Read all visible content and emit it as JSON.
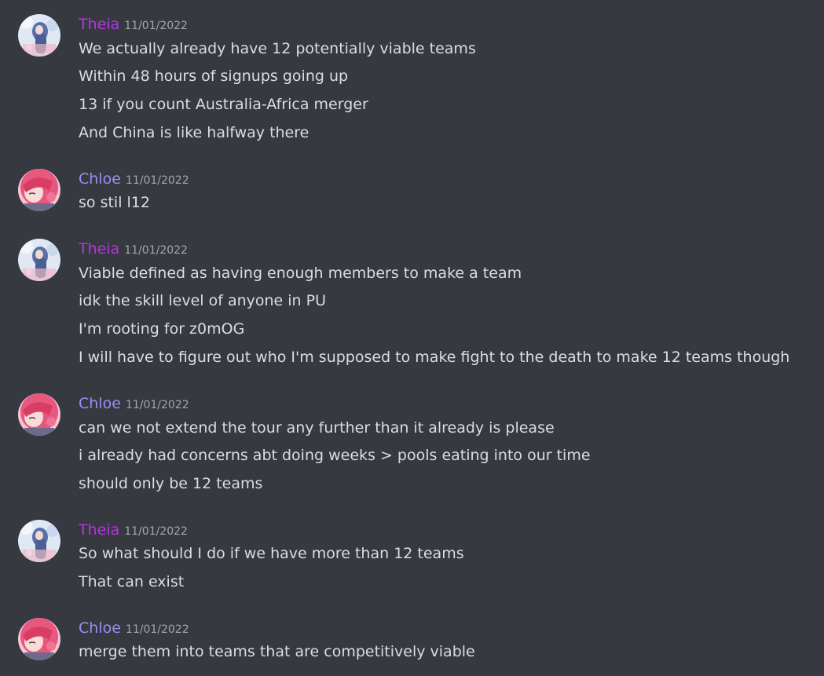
{
  "colors": {
    "background": "#36393f",
    "theia_name": "#b436e0",
    "chloe_name": "#9b8cf5",
    "text": "#dcddde",
    "timestamp": "#a3a6aa"
  },
  "messages": [
    {
      "author": "Theia",
      "timestamp": "11/01/2022",
      "avatar_icon": "blue-anime-character-avatar",
      "lines": [
        "We actually already have 12 potentially viable teams",
        "Within 48 hours of signups going up",
        "13 if you count Australia-Africa merger",
        "And China is like halfway there"
      ]
    },
    {
      "author": "Chloe",
      "timestamp": "11/01/2022",
      "avatar_icon": "pink-anime-character-avatar",
      "lines": [
        "so stil l12"
      ]
    },
    {
      "author": "Theia",
      "timestamp": "11/01/2022",
      "avatar_icon": "blue-anime-character-avatar",
      "lines": [
        "Viable defined as having enough members to make a team",
        "idk the skill level of anyone in PU",
        "I'm rooting for z0mOG",
        "I will have to figure out who I'm supposed to make fight to the death to make 12 teams though"
      ]
    },
    {
      "author": "Chloe",
      "timestamp": "11/01/2022",
      "avatar_icon": "pink-anime-character-avatar",
      "lines": [
        "can we not extend the tour any further than it already is please",
        "i already had concerns abt doing weeks > pools eating into our time",
        "should only be 12 teams"
      ]
    },
    {
      "author": "Theia",
      "timestamp": "11/01/2022",
      "avatar_icon": "blue-anime-character-avatar",
      "lines": [
        "So what should I do if we have more than 12 teams",
        "That can exist"
      ]
    },
    {
      "author": "Chloe",
      "timestamp": "11/01/2022",
      "avatar_icon": "pink-anime-character-avatar",
      "lines": [
        "merge them into teams that are competitively viable"
      ]
    }
  ]
}
